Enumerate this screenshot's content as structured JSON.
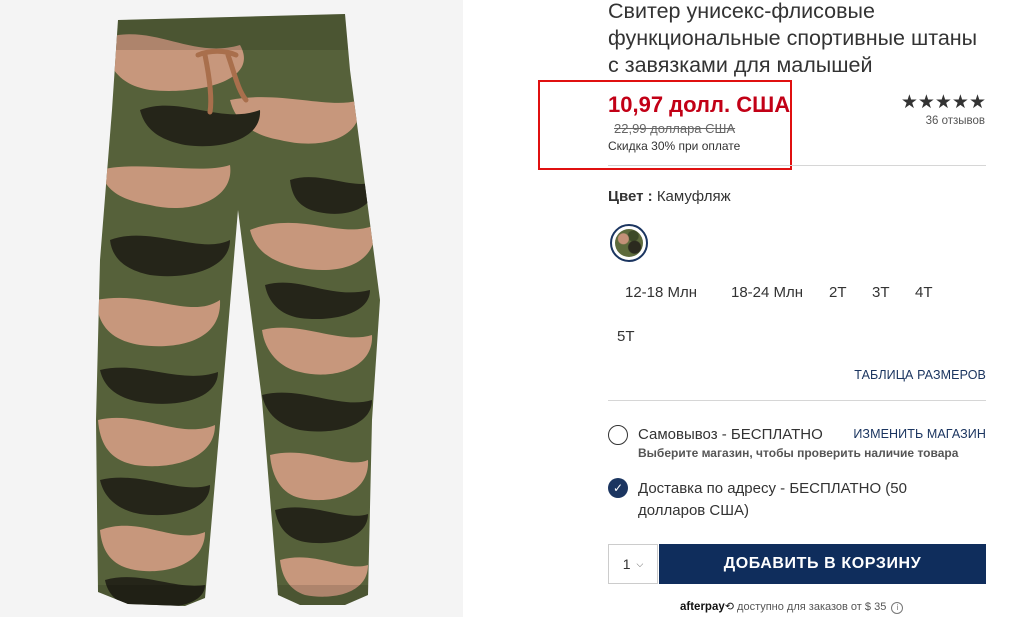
{
  "product": {
    "title": "Свитер унисекс-флисовые функциональные спортивные штаны с завязками для малышей",
    "image_alt": "Камуфляжные флисовые штаны"
  },
  "price": {
    "current": "10,97 долл. США",
    "original": "22,99 доллара США",
    "promo": "Скидка 30% при оплате",
    "color_sale": "#c20016"
  },
  "rating": {
    "stars": "★★★★★",
    "value": 4.5,
    "reviews": "36 отзывов"
  },
  "color": {
    "label": "Цвет :",
    "value": "Камуфляж"
  },
  "sizes": [
    "12-18 Млн",
    "18-24 Млн",
    "2T",
    "3T",
    "4T",
    "5T"
  ],
  "size_chart_label": "ТАБЛИЦА РАЗМЕРОВ",
  "fulfillment": {
    "pickup_label": "Самовывоз - БЕСПЛАТНО",
    "change_store": "ИЗМЕНИТЬ МАГАЗИН",
    "pickup_note": "Выберите магазин, чтобы проверить наличие товара",
    "shipping_label": "Доставка по адресу - БЕСПЛАТНО (50 долларов США)"
  },
  "cart": {
    "quantity": "1",
    "add_label": "ДОБАВИТЬ В КОРЗИНУ",
    "button_color": "#0f2d5c"
  },
  "afterpay": {
    "brand": "afterpay",
    "text": "доступно для заказов от $ 35"
  }
}
